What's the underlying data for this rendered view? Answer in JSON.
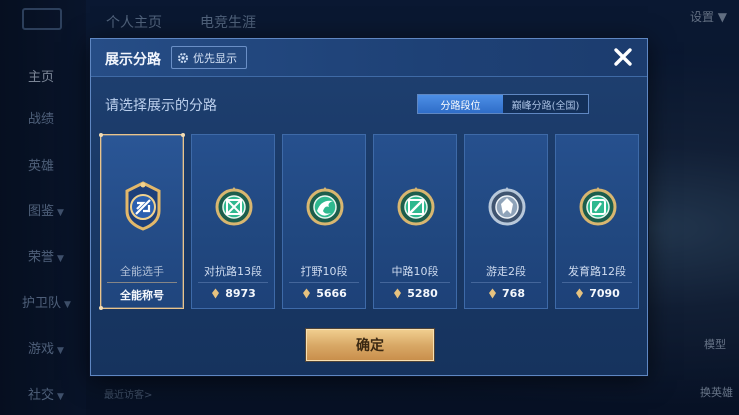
{
  "background": {
    "nav": [
      {
        "label": "主页",
        "active": true
      },
      {
        "label": "战绩"
      },
      {
        "label": "英雄"
      },
      {
        "label": "图鉴",
        "caret": "▼"
      },
      {
        "label": "荣誉",
        "caret": "▼"
      },
      {
        "label": "护卫队",
        "caret": "▼"
      },
      {
        "label": "游戏",
        "caret": "▼"
      },
      {
        "label": "社交",
        "caret": "▼"
      }
    ],
    "top_tabs": [
      "个人主页",
      "电竞生涯"
    ],
    "settings_label": "设置 ▼",
    "right_labels": [
      "模型",
      "换英雄"
    ],
    "bottom_hint": "最近访客>"
  },
  "modal": {
    "title": "展示分路",
    "priority_button": "优先显示",
    "prompt": "请选择展示的分路",
    "tabs": [
      {
        "label": "分路段位",
        "active": true
      },
      {
        "label": "巅峰分路(全国)",
        "active": false
      }
    ],
    "cards": [
      {
        "name": "全能选手",
        "footer": "全能称号",
        "badge_icon": "all-round-badge-icon",
        "selected": true
      },
      {
        "name": "对抗路13段",
        "score": "8973",
        "badge_icon": "clash-lane-badge-icon"
      },
      {
        "name": "打野10段",
        "score": "5666",
        "badge_icon": "jungle-badge-icon"
      },
      {
        "name": "中路10段",
        "score": "5280",
        "badge_icon": "mid-lane-badge-icon"
      },
      {
        "name": "游走2段",
        "score": "768",
        "badge_icon": "roam-badge-icon"
      },
      {
        "name": "发育路12段",
        "score": "7090",
        "badge_icon": "farm-lane-badge-icon"
      }
    ],
    "confirm_label": "确定"
  },
  "colors": {
    "accent_gold": "#e9c48c",
    "tab_active": "#3f7fd8",
    "badge_green": "#2fb88f",
    "badge_silver": "#9fb2c6"
  }
}
